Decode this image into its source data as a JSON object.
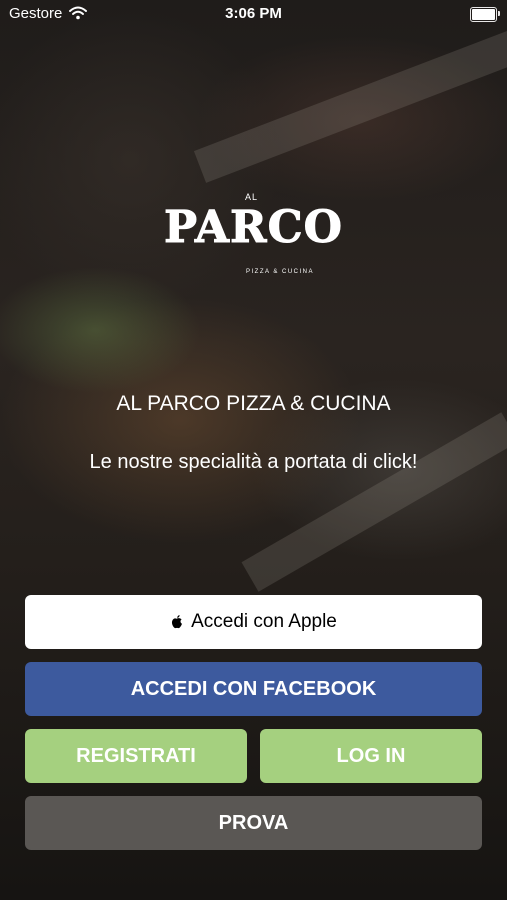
{
  "status_bar": {
    "carrier": "Gestore",
    "time": "3:06 PM",
    "battery_level": 1.0
  },
  "logo": {
    "al": "AL",
    "parco": "PARCO",
    "subtitle": "PIZZA & CUCINA"
  },
  "title": "AL PARCO PIZZA & CUCINA",
  "tagline": "Le nostre specialità a portata di click!",
  "buttons": {
    "apple": "Accedi con Apple",
    "facebook": "ACCEDI CON FACEBOOK",
    "register": "REGISTRATI",
    "login": "LOG IN",
    "try": "PROVA"
  },
  "colors": {
    "facebook": "#3d5a9e",
    "green": "#a5d07f",
    "gray": "#5a5754"
  }
}
